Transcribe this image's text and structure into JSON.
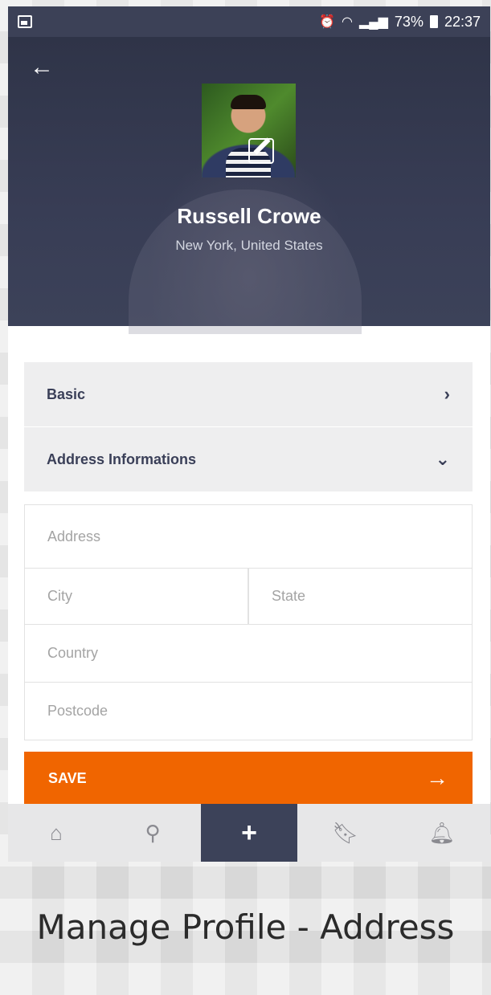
{
  "statusbar": {
    "battery": "73%",
    "time": "22:37"
  },
  "profile": {
    "name": "Russell Crowe",
    "location": "New York, United States"
  },
  "sections": {
    "basic": "Basic",
    "address": "Address Informations"
  },
  "form": {
    "address_placeholder": "Address",
    "city_placeholder": "City",
    "state_placeholder": "State",
    "country_placeholder": "Country",
    "postcode_placeholder": "Postcode"
  },
  "save": {
    "label": "SAVE"
  },
  "nav": {
    "items": [
      {
        "icon": "home-icon"
      },
      {
        "icon": "search-icon"
      },
      {
        "icon": "plus-icon"
      },
      {
        "icon": "bookmark-icon"
      },
      {
        "icon": "bell-icon"
      }
    ]
  },
  "colors": {
    "primary": "#3c4259",
    "accent": "#f06500"
  },
  "caption": "Manage Profile - Address"
}
